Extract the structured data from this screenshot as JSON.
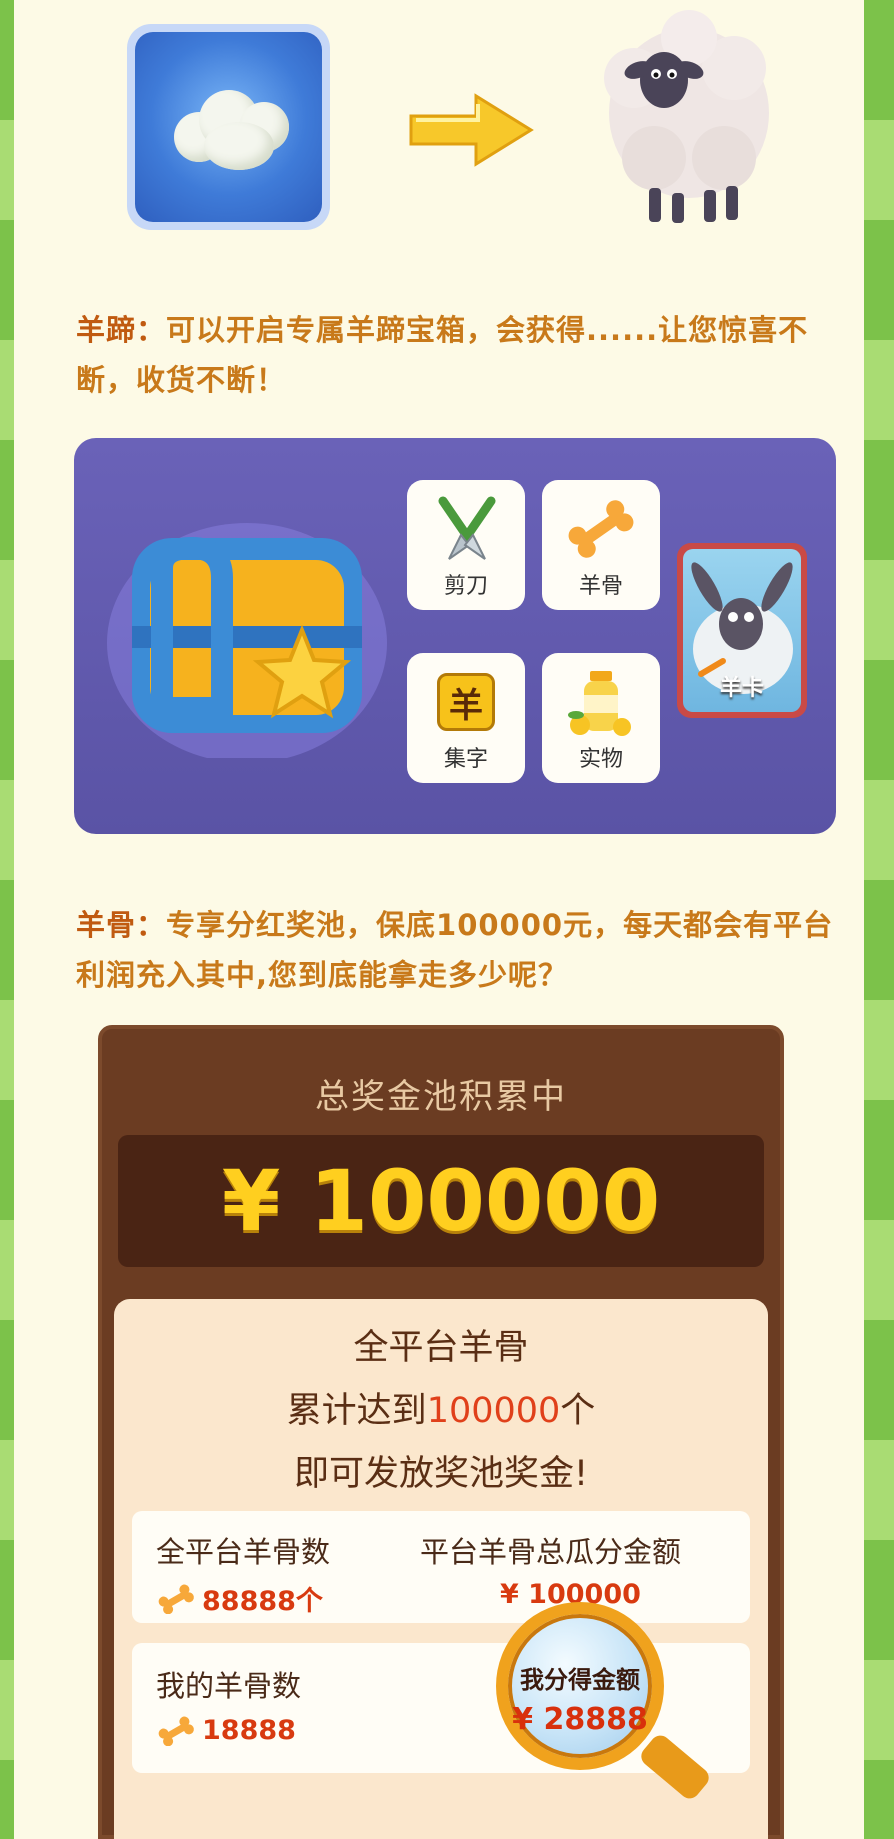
{
  "wool_section": {
    "wool_icon": "wool-cloud-icon",
    "arrow_icon": "arrow-right-icon",
    "sheep_icon": "sheep-icon"
  },
  "hoof_desc": {
    "head": "羊蹄：",
    "body": "可以开启专属羊蹄宝箱，会获得......让您惊喜不断，收货不断！"
  },
  "rewards": {
    "scissors": "剪刀",
    "bone": "羊骨",
    "char": "集字",
    "char_glyph": "羊",
    "goods": "实物",
    "card": "羊卡"
  },
  "bone_desc": {
    "head": "羊骨：",
    "body": "专享分红奖池，保底100000元，每天都会有平台利润充入其中,您到底能拿走多少呢？"
  },
  "pool": {
    "title": "总奖金池积累中",
    "amount": "¥ 100000",
    "rule_line1": "全平台羊骨",
    "rule_line2_pre": "累计达到",
    "rule_line2_num": "100000",
    "rule_line2_post": "个",
    "rule_line3": "即可发放奖池奖金!",
    "platform_bones_label": "全平台羊骨数",
    "platform_bones_value": "88888个",
    "platform_total_label": "平台羊骨总瓜分金额",
    "platform_total_value": "¥ 100000",
    "my_bones_label": "我的羊骨数",
    "my_bones_value": "18888",
    "my_share_label": "我分得金额",
    "my_share_value": "¥ 28888"
  }
}
